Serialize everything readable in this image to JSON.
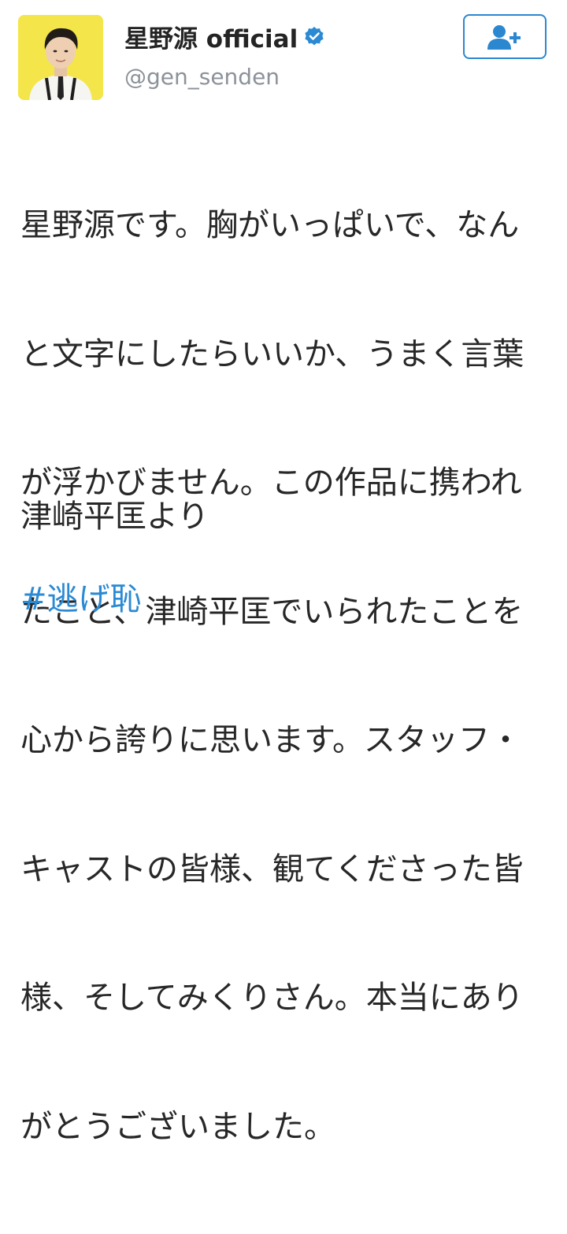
{
  "user": {
    "display_name": "星野源 official",
    "handle": "@gen_senden",
    "verified_icon": "verified-badge-icon",
    "avatar_icon": "profile-avatar"
  },
  "follow_button": {
    "icon": "add-user-icon",
    "accent_color": "#2b87cf"
  },
  "tweet": {
    "lines": [
      "星野源です。胸がいっぱいで、なん",
      "と文字にしたらいいか、うまく言葉",
      "が浮かびません。この作品に携われ",
      "たこと、津崎平匡でいられたことを",
      "心から誇りに思います。スタッフ・",
      "キャストの皆様、観てくださった皆",
      "様、そしてみくりさん。本当にあり",
      "がとうございました。"
    ],
    "signature": "津崎平匡より",
    "hashtag": "#逃げ恥",
    "hashtag_color": "#2b8ad3"
  }
}
